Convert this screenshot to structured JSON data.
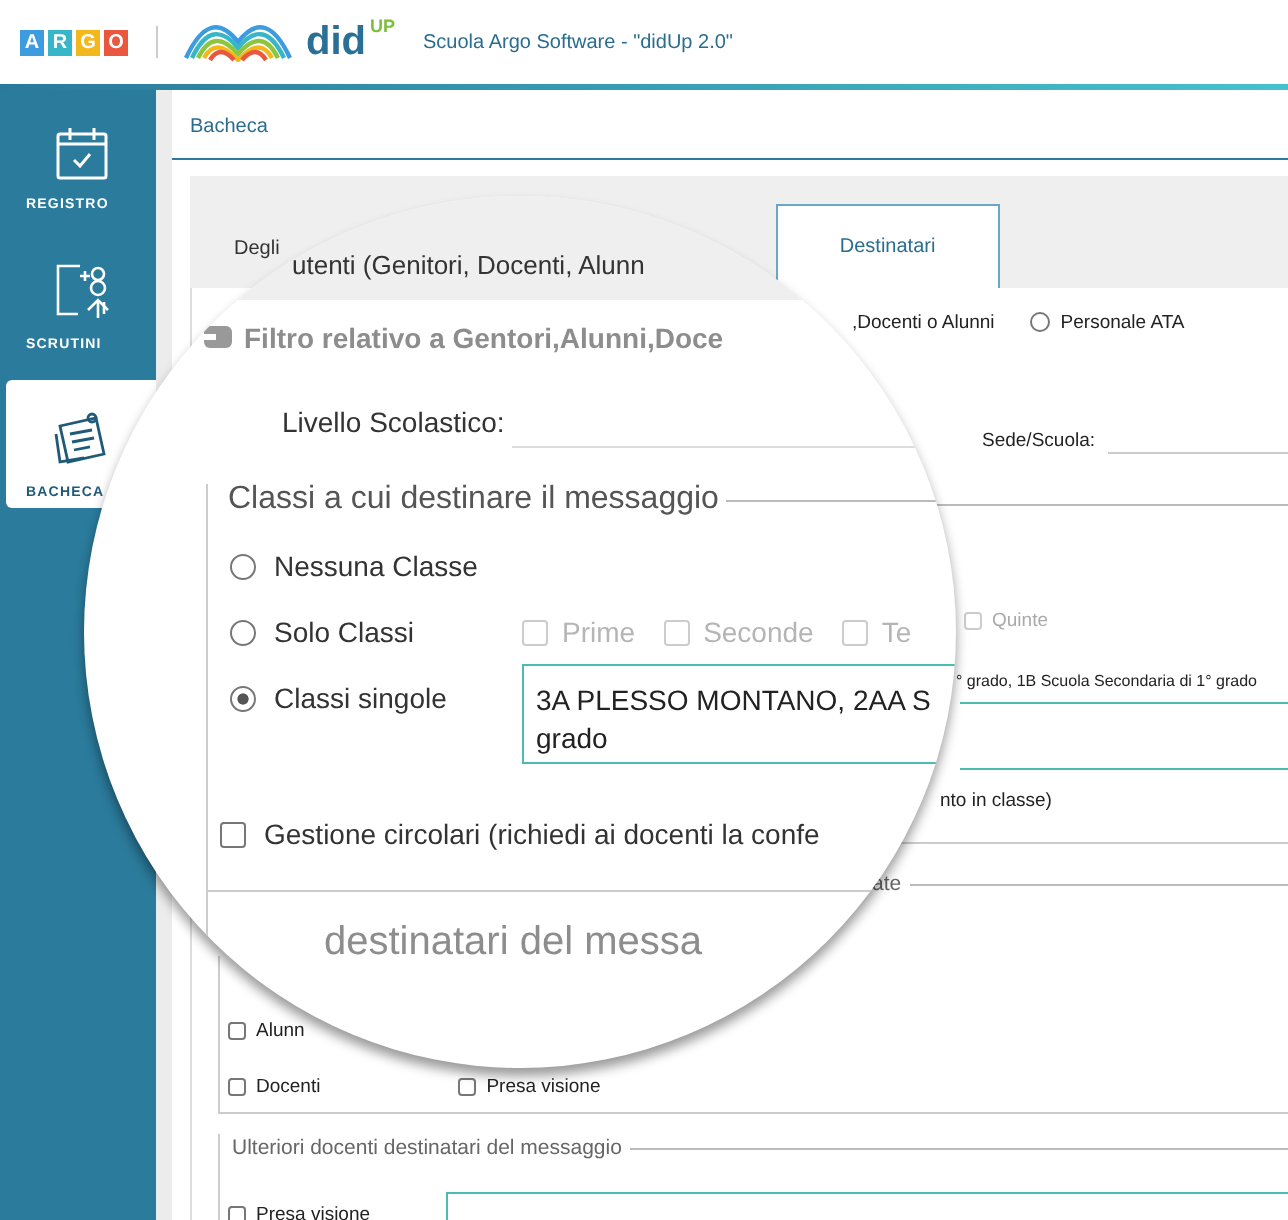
{
  "header": {
    "logo_letters": [
      {
        "letter": "A",
        "color": "#3d9be0"
      },
      {
        "letter": "R",
        "color": "#37b6c8"
      },
      {
        "letter": "G",
        "color": "#f2b81c"
      },
      {
        "letter": "O",
        "color": "#e8573e"
      }
    ],
    "app_name": "did",
    "app_sup": "UP",
    "title": "Scuola Argo Software - \"didUp 2.0\""
  },
  "sidebar": {
    "items": [
      {
        "label": "REGISTRO",
        "kind": "calendar",
        "selected": false
      },
      {
        "label": "SCRUTINI",
        "kind": "grades",
        "selected": false
      },
      {
        "label": "BACHECA",
        "kind": "board",
        "selected": true
      }
    ]
  },
  "breadcrumb": "Bacheca",
  "tabs": [
    {
      "label": "Degli",
      "magnified_label": "utenti (Genitori, Docenti, Alunn",
      "selected": false
    },
    {
      "label": "Destinatari",
      "selected": true
    }
  ],
  "filter": {
    "title": "Filtro relativo a Gentori,Alunni,Doce",
    "fragment": ",Docenti o Alunni",
    "radio": {
      "label": "Personale ATA",
      "selected": false
    }
  },
  "level_label": "Livello Scolastico:",
  "sede_label": "Sede/Scuola:",
  "classes": {
    "legend": "Classi a cui destinare il messaggio",
    "options": [
      {
        "label": "Nessuna Classe",
        "selected": false
      },
      {
        "label": "Solo Classi",
        "selected": false
      },
      {
        "label": "Classi singole",
        "selected": true
      }
    ],
    "lens_checks": [
      {
        "label": "Prime",
        "checked": false,
        "disabled": true
      },
      {
        "label": "Seconde",
        "checked": false,
        "disabled": true
      },
      {
        "label": "Te",
        "checked": false,
        "disabled": true
      }
    ],
    "quinte": {
      "label": "Quinte",
      "checked": false,
      "disabled": true
    },
    "selected_lines": [
      "3A PLESSO MONTANO, 2AA S",
      "grado"
    ],
    "side_text": "° grado, 1B Scuola Secondaria di 1° grado",
    "note": "nto in classe)"
  },
  "circolari": {
    "label": "Gestione circolari (richiedi ai docenti la confe",
    "checked": false
  },
  "legend_fragment": "ate",
  "recipients": {
    "legend": "destinatari del messa",
    "checks": [
      {
        "label": "Alunn",
        "checked": false
      },
      {
        "label": "Docenti",
        "checked": false
      },
      {
        "label": "Presa visione",
        "checked": false
      }
    ]
  },
  "extra": {
    "legend": "Ulteriori docenti destinatari del messaggio",
    "checks": [
      {
        "label": "Presa visione",
        "checked": false
      }
    ]
  }
}
